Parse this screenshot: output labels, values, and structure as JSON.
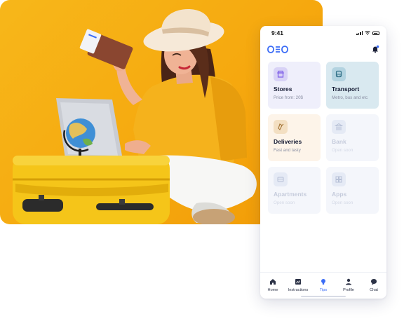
{
  "status_bar": {
    "time": "9:41"
  },
  "app": {
    "logo_text": "OEO"
  },
  "colors": {
    "accent": "#3b6cf6",
    "photo_background": "#f6a90f",
    "stores_card": "#efeffb",
    "transport_card": "#d9e9f0",
    "deliveries_card": "#fdf4e9",
    "disabled_card": "#f4f6fb"
  },
  "cards": [
    {
      "title": "Stores",
      "subtitle": "Price from: 20$",
      "icon": "store-icon",
      "enabled": true
    },
    {
      "title": "Transport",
      "subtitle": "Metro, bus and etc",
      "icon": "bus-icon",
      "enabled": true
    },
    {
      "title": "Deliveries",
      "subtitle": "Fast and tasty",
      "icon": "delivery-icon",
      "enabled": true
    },
    {
      "title": "Bank",
      "subtitle": "Open soon",
      "icon": "bank-icon",
      "enabled": false
    },
    {
      "title": "Apartments",
      "subtitle": "Open soon",
      "icon": "apartment-icon",
      "enabled": false
    },
    {
      "title": "Apps",
      "subtitle": "Open soon",
      "icon": "apps-icon",
      "enabled": false
    }
  ],
  "nav": [
    {
      "label": "Home",
      "icon": "home-icon",
      "active": false
    },
    {
      "label": "Instructions",
      "icon": "instructions-icon",
      "active": false
    },
    {
      "label": "Tips",
      "icon": "lightbulb-icon",
      "active": true
    },
    {
      "label": "Profile",
      "icon": "profile-icon",
      "active": false
    },
    {
      "label": "Chat",
      "icon": "chat-icon",
      "active": false
    }
  ]
}
